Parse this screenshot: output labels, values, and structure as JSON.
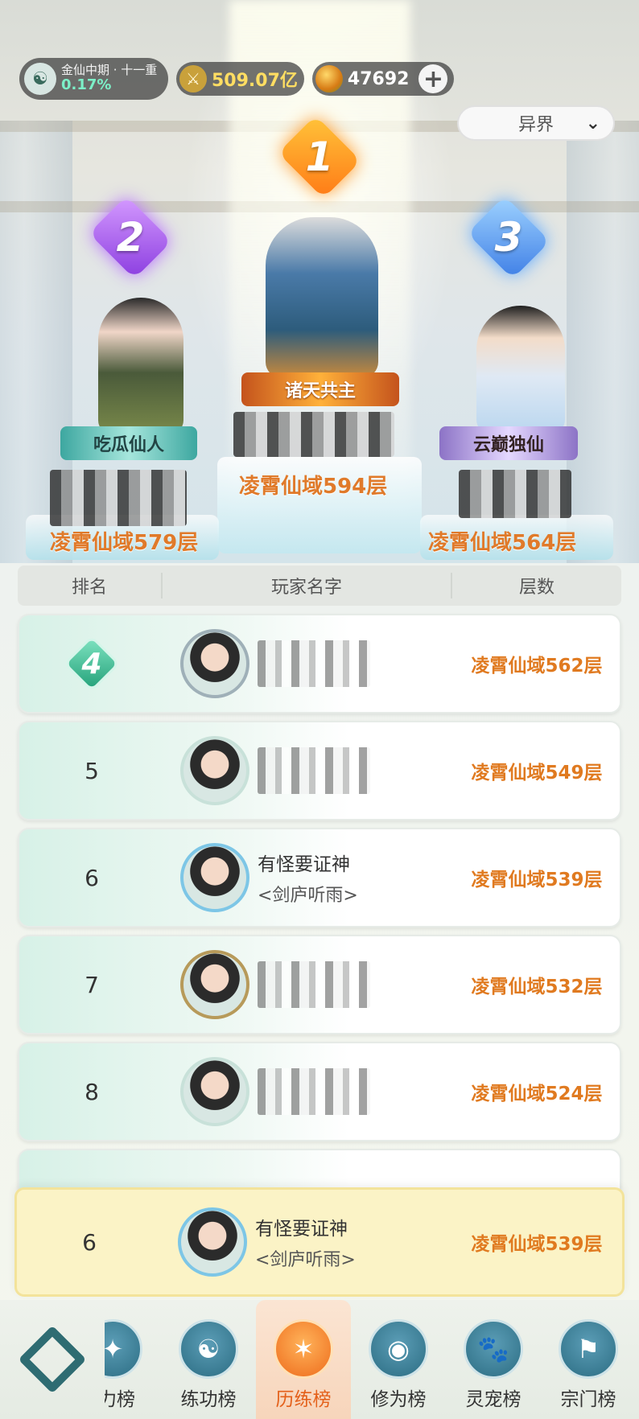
{
  "header": {
    "cultivation_rank": "金仙中期 · 十一重",
    "cultivation_progress": "0.17%",
    "combat_power": "509.07亿",
    "currency": "47692",
    "region_selected": "异界"
  },
  "podium": [
    {
      "rank": "1",
      "title": "诸天共主",
      "floor": "凌霄仙域594层"
    },
    {
      "rank": "2",
      "title": "吃瓜仙人",
      "floor": "凌霄仙域579层"
    },
    {
      "rank": "3",
      "title": "云巅独仙",
      "floor": "凌霄仙域564层"
    }
  ],
  "table": {
    "headers": [
      "排名",
      "玩家名字",
      "层数"
    ],
    "rows": [
      {
        "rank": "4",
        "name": "",
        "guild": "",
        "floor": "凌霄仙域562层"
      },
      {
        "rank": "5",
        "name": "",
        "guild": "",
        "floor": "凌霄仙域549层"
      },
      {
        "rank": "6",
        "name": "有怪要证神",
        "guild": "<剑庐听雨>",
        "floor": "凌霄仙域539层"
      },
      {
        "rank": "7",
        "name": "",
        "guild": "",
        "floor": "凌霄仙域532层"
      },
      {
        "rank": "8",
        "name": "",
        "guild": "",
        "floor": "凌霄仙域524层"
      }
    ]
  },
  "self": {
    "rank": "6",
    "name": "有怪要证神",
    "guild": "<剑庐听雨>",
    "floor": "凌霄仙域539层"
  },
  "nav": {
    "tabs": [
      {
        "label": "力榜"
      },
      {
        "label": "练功榜"
      },
      {
        "label": "历练榜"
      },
      {
        "label": "修为榜"
      },
      {
        "label": "灵宠榜"
      },
      {
        "label": "宗门榜"
      }
    ]
  }
}
